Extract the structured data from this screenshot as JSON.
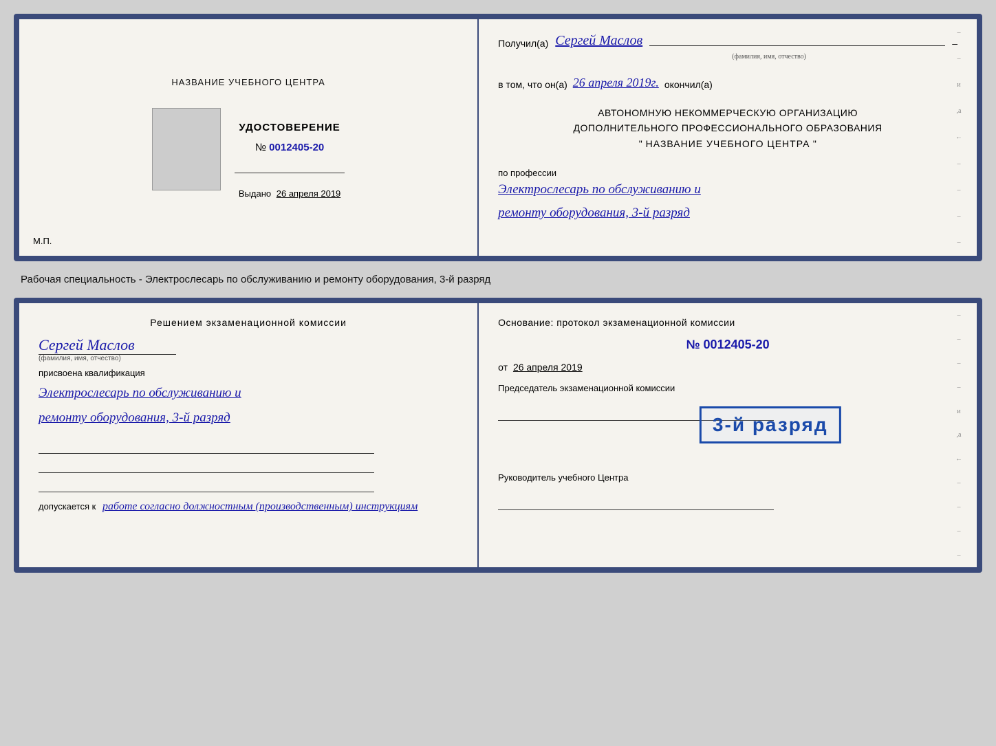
{
  "page": {
    "background": "#d0d0d0"
  },
  "document1": {
    "left": {
      "institution_name": "НАЗВАНИЕ УЧЕБНОГО ЦЕНТРА",
      "photo_alt": "Фото",
      "title": "УДОСТОВЕРЕНИЕ",
      "number_prefix": "№",
      "number_value": "0012405-20",
      "issued_prefix": "Выдано",
      "issued_date": "26 апреля 2019",
      "mp_label": "М.П."
    },
    "right": {
      "received_label": "Получил(а)",
      "recipient_name": "Сергей Маслов",
      "recipient_subtitle": "(фамилия, имя, отчество)",
      "vtom_prefix": "в том, что он(а)",
      "vtom_date": "26 апреля 2019г.",
      "vtom_suffix": "окончил(а)",
      "org_line1": "АВТОНОМНУЮ НЕКОММЕРЧЕСКУЮ ОРГАНИЗАЦИЮ",
      "org_line2": "ДОПОЛНИТЕЛЬНОГО ПРОФЕССИОНАЛЬНОГО ОБРАЗОВАНИЯ",
      "org_quote_open": "\"",
      "org_name": "НАЗВАНИЕ УЧЕБНОГО ЦЕНТРА",
      "org_quote_close": "\"",
      "profession_label": "по профессии",
      "profession_text1": "Электрослесарь по обслуживанию и",
      "profession_text2": "ремонту оборудования, 3-й разряд"
    }
  },
  "between_text": "Рабочая специальность - Электрослесарь по обслуживанию и ремонту оборудования, 3-й разряд",
  "document2": {
    "left": {
      "decision_title": "Решением экзаменационной комиссии",
      "name": "Сергей Маслов",
      "name_subtitle": "(фамилия, имя, отчество)",
      "qualification_label": "присвоена квалификация",
      "qualification_text1": "Электрослесарь по обслуживанию и",
      "qualification_text2": "ремонту оборудования, 3-й разряд",
      "допускается_prefix": "допускается к",
      "допускается_text": "работе согласно должностным (производственным) инструкциям"
    },
    "right": {
      "osnov_label": "Основание: протокол экзаменационной комиссии",
      "doc_number": "№ 0012405-20",
      "date_prefix": "от",
      "date_value": "26 апреля 2019",
      "chairman_label": "Председатель экзаменационной комиссии",
      "stamp_text": "3-й разряд",
      "rukovoditel_label": "Руководитель учебного Центра"
    }
  }
}
